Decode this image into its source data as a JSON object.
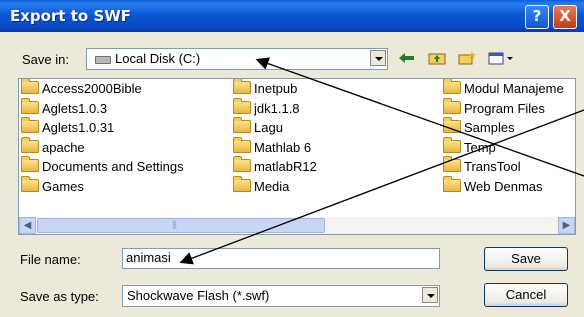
{
  "window": {
    "title": "Export to SWF",
    "help_label": "?",
    "close_label": "X"
  },
  "save_in": {
    "label": "Save in:",
    "value": "Local Disk (C:)"
  },
  "toolbar": {
    "back_icon": "back-arrow-icon",
    "up_icon": "up-folder-icon",
    "new_folder_icon": "new-folder-icon",
    "view_icon": "view-menu-icon"
  },
  "files": {
    "column1": [
      "Access2000Bible",
      "Aglets1.0.3",
      "Aglets1.0.31",
      "apache",
      "Documents and Settings",
      "Games"
    ],
    "column2": [
      "Inetpub",
      "jdk1.1.8",
      "Lagu",
      "Mathlab 6",
      "matlabR12",
      "Media"
    ],
    "column3": [
      "Modul Manajeme",
      "Program Files",
      "Samples",
      "Temp",
      "TransTool",
      "Web Denmas"
    ]
  },
  "file_name": {
    "label": "File name:",
    "value": "animasi"
  },
  "save_as_type": {
    "label": "Save as type:",
    "value": "Shockwave Flash (*.swf)"
  },
  "buttons": {
    "save": "Save",
    "cancel": "Cancel"
  },
  "colors": {
    "title_bar": "#0a58d4",
    "dialog_bg": "#ece9d8",
    "border": "#7f9db9",
    "folder": "#f5cf5c"
  }
}
